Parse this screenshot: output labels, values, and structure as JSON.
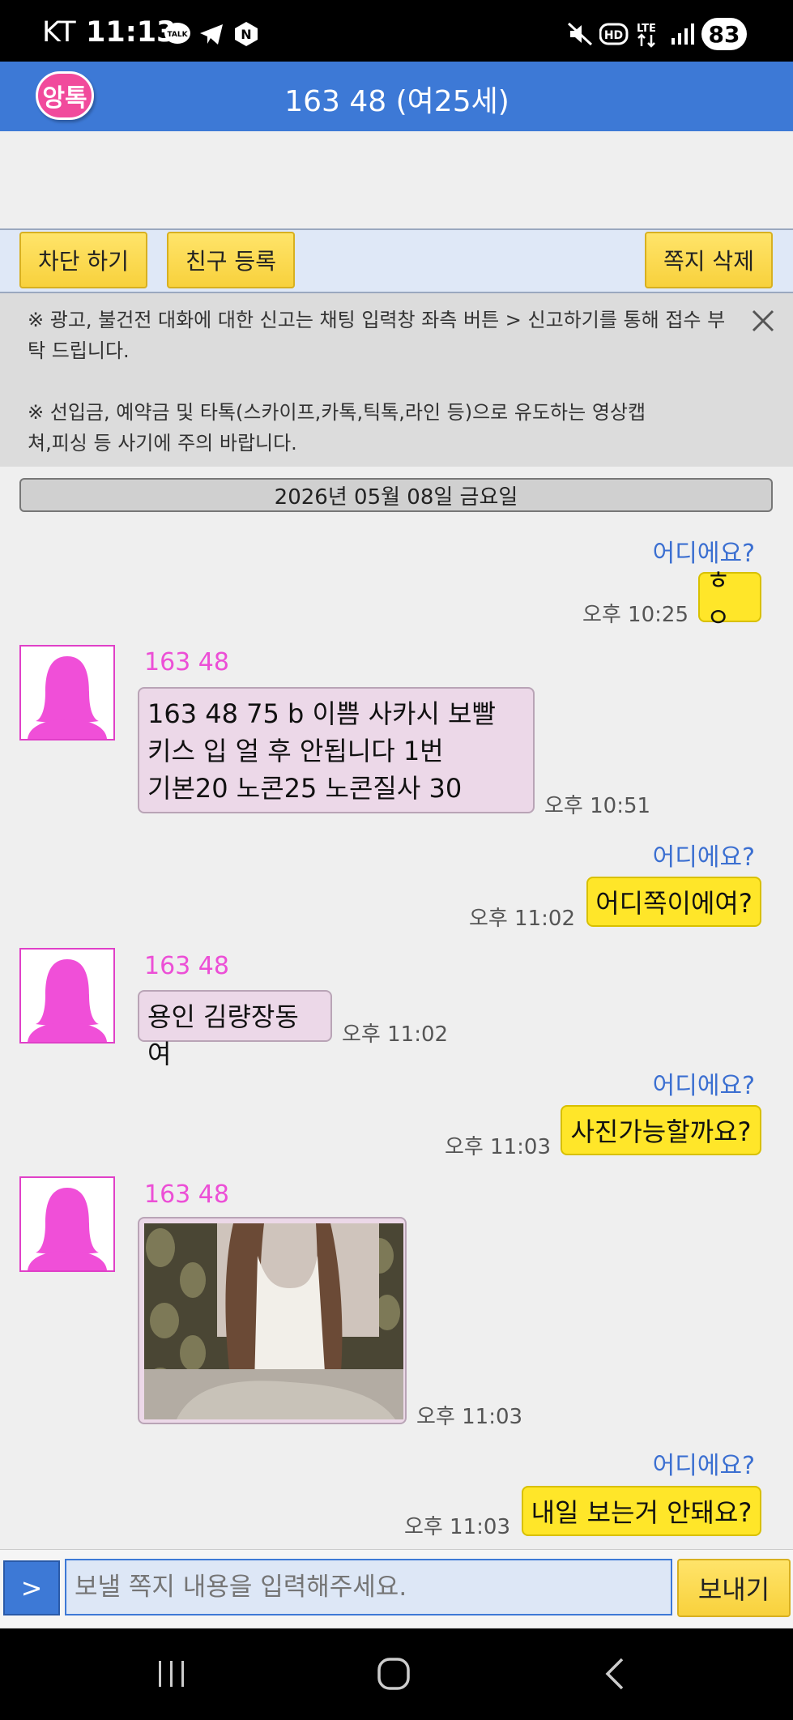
{
  "status_bar": {
    "carrier": "KT",
    "time": "11:13",
    "battery": "83",
    "icons": [
      "talk-icon",
      "telegram-icon",
      "naver-icon",
      "mute-icon",
      "hd-icon",
      "lte-icon",
      "signal-icon"
    ],
    "hd": "HD",
    "lte": "LTE"
  },
  "header": {
    "logo_text": "앙톡",
    "title": "163 48 (여25세)"
  },
  "actions": {
    "block": "차단 하기",
    "add_friend": "친구 등록",
    "delete": "쪽지 삭제"
  },
  "notice": {
    "line1": "※ 광고, 불건전 대화에 대한 신고는 채팅 입력창 좌측 버튼 > 신고하기를 통해 접수 부탁 드립니다.",
    "line2": "※ 선입금, 예약금 및 타톡(스카이프,카톡,틱톡,라인 등)으로 유도하는 영상캡쳐,피싱 등 사기에 주의 바랍니다."
  },
  "date": "2026년 05월 08일 금요일",
  "messages": [
    {
      "from": "me",
      "label": "어디에요?",
      "text": "ㅎㅇ",
      "time": "오후 10:25"
    },
    {
      "from": "them",
      "name": "163 48",
      "lines": [
        "163 48 75 b 이쁨 사카시 보빨",
        "키스 입 얼 후 안됩니다 1번",
        "기본20 노콘25 노콘질사 30"
      ],
      "time": "오후 10:51"
    },
    {
      "from": "me",
      "label": "어디에요?",
      "text": "어디쪽이에여?",
      "time": "오후 11:02"
    },
    {
      "from": "them",
      "name": "163 48",
      "lines": [
        "용인 김량장동여"
      ],
      "time": "오후 11:02"
    },
    {
      "from": "me",
      "label": "어디에요?",
      "text": "사진가능할까요?",
      "time": "오후 11:03"
    },
    {
      "from": "them",
      "name": "163 48",
      "photo": true,
      "time": "오후 11:03"
    },
    {
      "from": "me",
      "label": "어디에요?",
      "text": "내일 보는거 안돼요?",
      "time": "오후 11:03"
    }
  ],
  "input": {
    "arrow": ">",
    "placeholder": "보낼 쪽지 내용을 입력해주세요.",
    "send": "보내기"
  },
  "colors": {
    "header": "#3d79d6",
    "my_bubble": "#ffe629",
    "their_bubble": "#ecd8e8",
    "name": "#ec4fd6",
    "label": "#3b6fd1"
  }
}
